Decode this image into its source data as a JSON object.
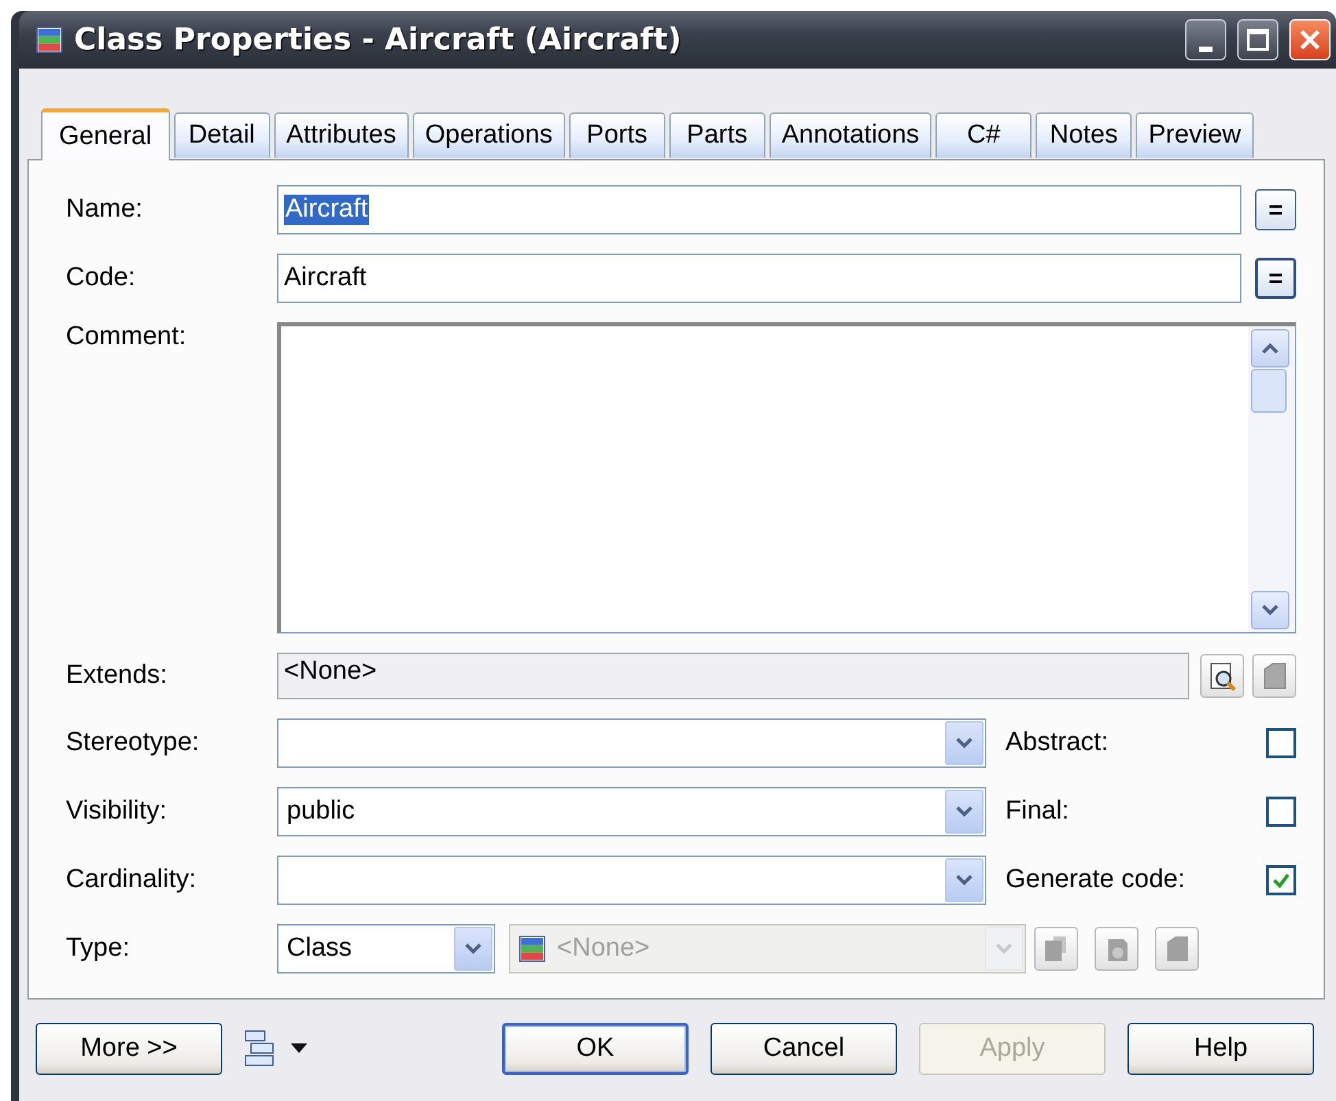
{
  "window": {
    "title": "Class Properties - Aircraft (Aircraft)"
  },
  "tabs": [
    {
      "label": "General",
      "selected": true
    },
    {
      "label": "Detail",
      "selected": false
    },
    {
      "label": "Attributes",
      "selected": false
    },
    {
      "label": "Operations",
      "selected": false
    },
    {
      "label": "Ports",
      "selected": false
    },
    {
      "label": "Parts",
      "selected": false
    },
    {
      "label": "Annotations",
      "selected": false
    },
    {
      "label": "C#",
      "selected": false
    },
    {
      "label": "Notes",
      "selected": false
    },
    {
      "label": "Preview",
      "selected": false
    }
  ],
  "text_fields": [
    {
      "label": "Name:",
      "value": "Aircraft",
      "selected": true,
      "button": "="
    },
    {
      "label": "Code:",
      "value": "Aircraft",
      "selected": false,
      "button": "="
    }
  ],
  "comment": {
    "label": "Comment:"
  },
  "extends": {
    "label": "Extends:",
    "value": "<None>"
  },
  "combos": [
    {
      "label": "Stereotype:"
    },
    {
      "label": "Visibility:",
      "value": "public"
    },
    {
      "label": "Cardinality:"
    }
  ],
  "checkboxes": [
    {
      "label": "Abstract:",
      "checked": false
    },
    {
      "label": "Final:",
      "checked": false
    },
    {
      "label": "Generate code:",
      "checked": true
    }
  ],
  "type": {
    "label": "Type:",
    "value": "Class",
    "classifier": "<None>",
    "disabled": true
  },
  "more_button": "More >>",
  "buttons": [
    {
      "label": "OK",
      "default": true,
      "disabled": false
    },
    {
      "label": "Cancel",
      "default": false,
      "disabled": false
    },
    {
      "label": "Apply",
      "default": false,
      "disabled": true
    },
    {
      "label": "Help",
      "default": false,
      "disabled": false
    }
  ]
}
